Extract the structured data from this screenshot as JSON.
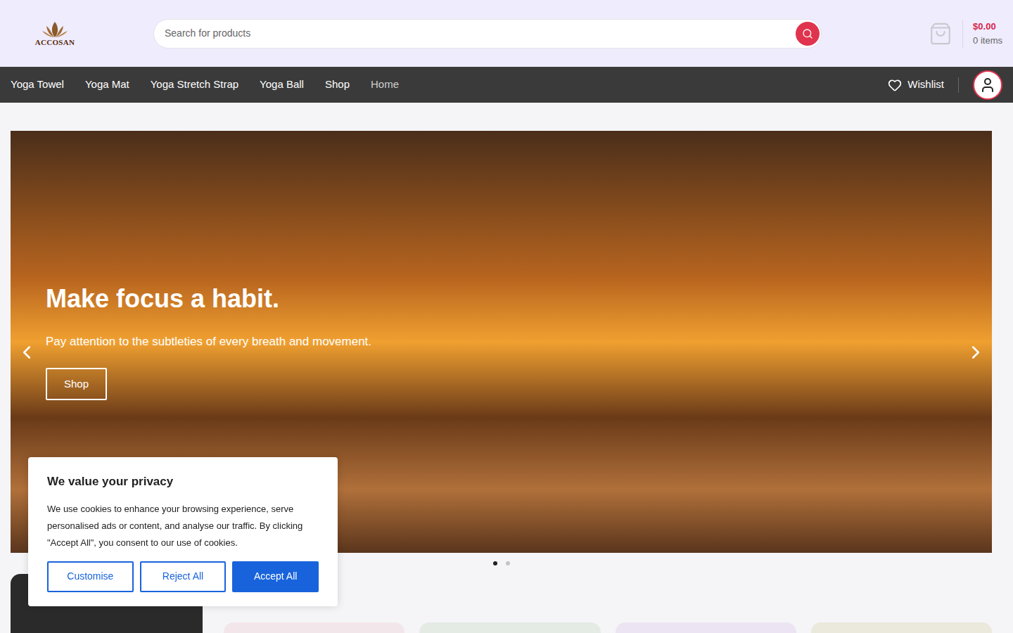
{
  "logo": {
    "text": "ACCOSAN"
  },
  "search": {
    "placeholder": "Search for products"
  },
  "cart": {
    "total": "$0.00",
    "items": "0 items"
  },
  "nav": [
    {
      "label": "Yoga Towel",
      "selected": false
    },
    {
      "label": "Yoga Mat",
      "selected": false
    },
    {
      "label": "Yoga Stretch Strap",
      "selected": false
    },
    {
      "label": "Yoga Ball",
      "selected": false
    },
    {
      "label": "Shop",
      "selected": false
    },
    {
      "label": "Home",
      "selected": true
    }
  ],
  "wishlist": {
    "label": "Wishlist"
  },
  "hero": {
    "title": "Make focus a habit.",
    "subtitle": "Pay attention to the subtleties of every breath and movement.",
    "button": "Shop",
    "slides": [
      {
        "selected": true
      },
      {
        "selected": false
      }
    ]
  },
  "cookie": {
    "title": "We value your privacy",
    "body": "We use cookies to enhance your browsing experience, serve personalised ads or content, and analyse our traffic. By clicking \"Accept All\", you consent to our use of cookies.",
    "buttons": [
      {
        "label": "Customise",
        "kind": "outline"
      },
      {
        "label": "Reject All",
        "kind": "outline"
      },
      {
        "label": "Accept All",
        "kind": "primary"
      }
    ]
  }
}
